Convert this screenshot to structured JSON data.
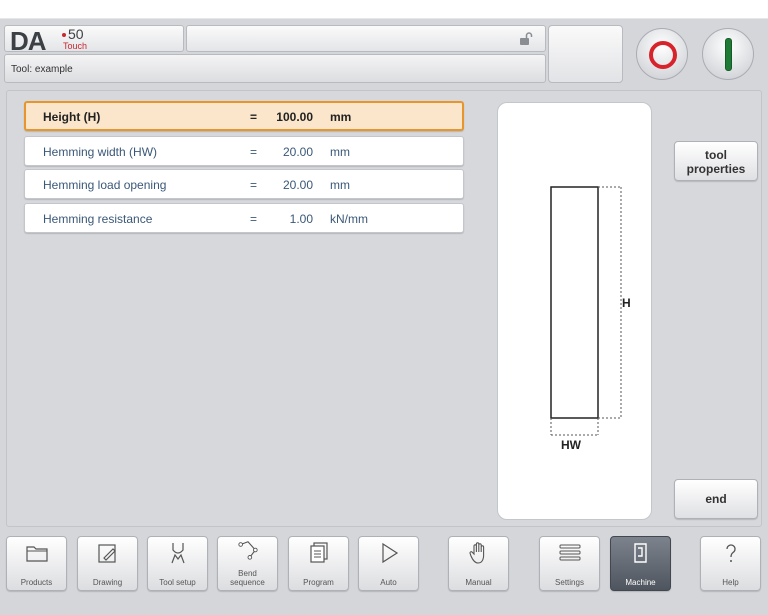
{
  "header": {
    "logo": {
      "brand": "DA",
      "model": "50",
      "edition": "Touch"
    },
    "title": "Tool: example"
  },
  "params": [
    {
      "label": "Height (H)",
      "eq": "=",
      "value": "100.00",
      "unit": "mm"
    },
    {
      "label": "Hemming width (HW)",
      "eq": "=",
      "value": "20.00",
      "unit": "mm"
    },
    {
      "label": "Hemming load opening",
      "eq": "=",
      "value": "20.00",
      "unit": "mm"
    },
    {
      "label": "Hemming resistance",
      "eq": "=",
      "value": "1.00",
      "unit": "kN/mm"
    }
  ],
  "drawing": {
    "height_label": "H",
    "width_label": "HW"
  },
  "side": {
    "tool_properties_l1": "tool",
    "tool_properties_l2": "properties",
    "end": "end"
  },
  "nav": [
    {
      "label": "Products",
      "icon": "folder-icon"
    },
    {
      "label": "Drawing",
      "icon": "pencil-icon"
    },
    {
      "label": "Tool setup",
      "icon": "tool-setup-icon"
    },
    {
      "label_l1": "Bend",
      "label_l2": "sequence",
      "icon": "bend-sequence-icon"
    },
    {
      "label": "Program",
      "icon": "program-icon"
    },
    {
      "label": "Auto",
      "icon": "play-icon"
    },
    {
      "label": "Manual",
      "icon": "hand-icon"
    },
    {
      "label": "Settings",
      "icon": "settings-list-icon"
    },
    {
      "label": "Machine",
      "icon": "machine-icon"
    },
    {
      "label": "Help",
      "icon": "question-icon"
    }
  ],
  "colors": {
    "selected_bg": "#fbe6cb",
    "selected_border": "#e7962d",
    "stop": "#d7232b",
    "start": "#1f7a35",
    "logo_accent": "#c8282f"
  }
}
